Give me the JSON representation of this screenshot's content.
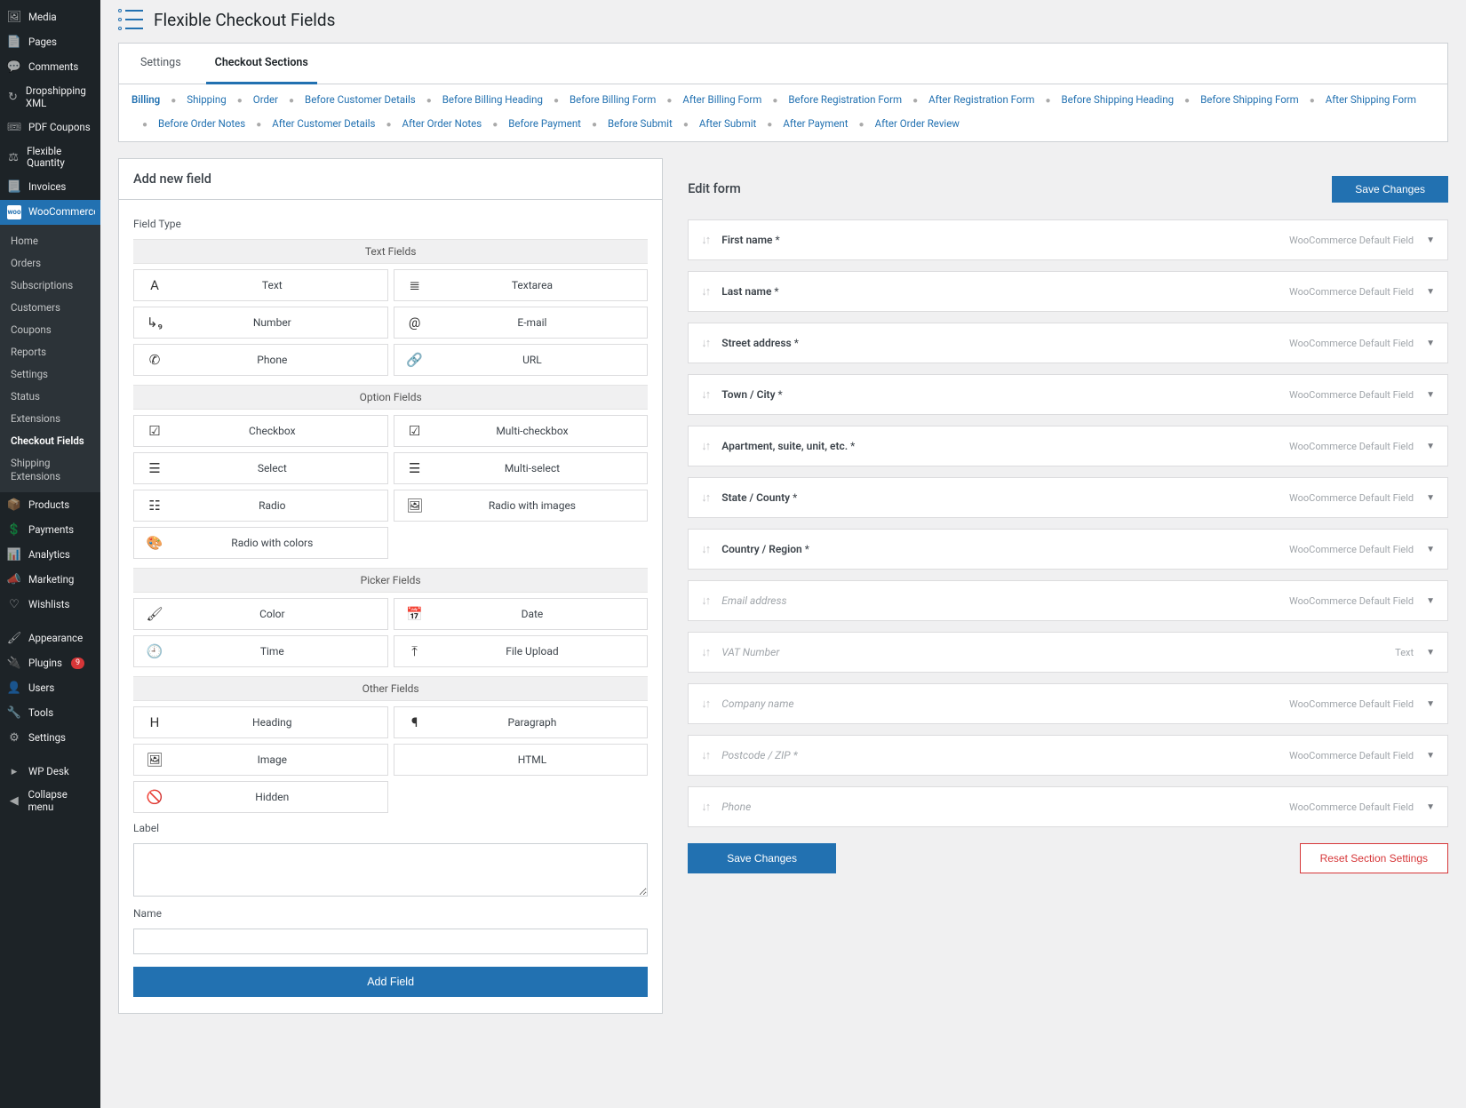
{
  "sidebar": {
    "items": [
      {
        "icon": "🖼",
        "label": "Media"
      },
      {
        "icon": "📄",
        "label": "Pages"
      },
      {
        "icon": "💬",
        "label": "Comments"
      },
      {
        "icon": "↻",
        "label": "Dropshipping XML"
      },
      {
        "icon": "🎟",
        "label": "PDF Coupons"
      },
      {
        "icon": "⚖",
        "label": "Flexible Quantity"
      },
      {
        "icon": "📃",
        "label": "Invoices"
      }
    ],
    "woo": {
      "icon": "woo",
      "label": "WooCommerce"
    },
    "submenu": [
      "Home",
      "Orders",
      "Subscriptions",
      "Customers",
      "Coupons",
      "Reports",
      "Settings",
      "Status",
      "Extensions",
      "Checkout Fields",
      "Shipping Extensions"
    ],
    "submenu_active": "Checkout Fields",
    "items2": [
      {
        "icon": "📦",
        "label": "Products"
      },
      {
        "icon": "💲",
        "label": "Payments"
      },
      {
        "icon": "📊",
        "label": "Analytics"
      },
      {
        "icon": "📣",
        "label": "Marketing"
      },
      {
        "icon": "♡",
        "label": "Wishlists"
      }
    ],
    "items3": [
      {
        "icon": "🖌",
        "label": "Appearance"
      },
      {
        "icon": "🔌",
        "label": "Plugins",
        "badge": "9"
      },
      {
        "icon": "👤",
        "label": "Users"
      },
      {
        "icon": "🔧",
        "label": "Tools"
      },
      {
        "icon": "⚙",
        "label": "Settings"
      }
    ],
    "items4": [
      {
        "icon": "▸",
        "label": "WP Desk"
      },
      {
        "icon": "◀",
        "label": "Collapse menu"
      }
    ]
  },
  "page": {
    "title": "Flexible Checkout Fields"
  },
  "tabs": [
    {
      "label": "Settings",
      "active": false
    },
    {
      "label": "Checkout Sections",
      "active": true
    }
  ],
  "subtabs": [
    "Billing",
    "Shipping",
    "Order",
    "Before Customer Details",
    "Before Billing Heading",
    "Before Billing Form",
    "After Billing Form",
    "Before Registration Form",
    "After Registration Form",
    "Before Shipping Heading",
    "Before Shipping Form",
    "After Shipping Form",
    "Before Order Notes",
    "After Customer Details",
    "After Order Notes",
    "Before Payment",
    "Before Submit",
    "After Submit",
    "After Payment",
    "After Order Review"
  ],
  "subtab_active": "Billing",
  "add_panel": {
    "title": "Add new field",
    "field_type_label": "Field Type",
    "groups": [
      {
        "header": "Text Fields",
        "items": [
          {
            "icon": "A",
            "label": "Text"
          },
          {
            "icon": "≣",
            "label": "Textarea"
          },
          {
            "icon": "↳₉",
            "label": "Number"
          },
          {
            "icon": "@",
            "label": "E-mail"
          },
          {
            "icon": "✆",
            "label": "Phone"
          },
          {
            "icon": "🔗",
            "label": "URL"
          }
        ]
      },
      {
        "header": "Option Fields",
        "items": [
          {
            "icon": "☑",
            "label": "Checkbox"
          },
          {
            "icon": "☑",
            "label": "Multi-checkbox"
          },
          {
            "icon": "☰",
            "label": "Select"
          },
          {
            "icon": "☰",
            "label": "Multi-select"
          },
          {
            "icon": "☷",
            "label": "Radio"
          },
          {
            "icon": "🖼",
            "label": "Radio with images"
          },
          {
            "icon": "🎨",
            "label": "Radio with colors"
          }
        ]
      },
      {
        "header": "Picker Fields",
        "items": [
          {
            "icon": "🖌",
            "label": "Color"
          },
          {
            "icon": "📅",
            "label": "Date"
          },
          {
            "icon": "🕘",
            "label": "Time"
          },
          {
            "icon": "⤒",
            "label": "File Upload"
          }
        ]
      },
      {
        "header": "Other Fields",
        "items": [
          {
            "icon": "H",
            "label": "Heading"
          },
          {
            "icon": "¶",
            "label": "Paragraph"
          },
          {
            "icon": "🖼",
            "label": "Image"
          },
          {
            "icon": "</>",
            "label": "HTML"
          },
          {
            "icon": "🚫",
            "label": "Hidden"
          }
        ]
      }
    ],
    "label_label": "Label",
    "name_label": "Name",
    "add_button": "Add Field"
  },
  "edit_panel": {
    "title": "Edit form",
    "save_button": "Save Changes",
    "reset_button": "Reset Section Settings",
    "default_type": "WooCommerce Default Field",
    "fields": [
      {
        "name": "First name",
        "required": true,
        "type": "WooCommerce Default Field",
        "disabled": false
      },
      {
        "name": "Last name",
        "required": true,
        "type": "WooCommerce Default Field",
        "disabled": false
      },
      {
        "name": "Street address",
        "required": true,
        "type": "WooCommerce Default Field",
        "disabled": false
      },
      {
        "name": "Town / City",
        "required": true,
        "type": "WooCommerce Default Field",
        "disabled": false
      },
      {
        "name": "Apartment, suite, unit, etc.",
        "required": true,
        "type": "WooCommerce Default Field",
        "disabled": false
      },
      {
        "name": "State / County",
        "required": true,
        "type": "WooCommerce Default Field",
        "disabled": false
      },
      {
        "name": "Country / Region",
        "required": true,
        "type": "WooCommerce Default Field",
        "disabled": false
      },
      {
        "name": "Email address",
        "required": false,
        "type": "WooCommerce Default Field",
        "disabled": true
      },
      {
        "name": "VAT Number",
        "required": false,
        "type": "Text",
        "disabled": true
      },
      {
        "name": "Company name",
        "required": false,
        "type": "WooCommerce Default Field",
        "disabled": true
      },
      {
        "name": "Postcode / ZIP",
        "required": true,
        "type": "WooCommerce Default Field",
        "disabled": true
      },
      {
        "name": "Phone",
        "required": false,
        "type": "WooCommerce Default Field",
        "disabled": true
      }
    ]
  }
}
